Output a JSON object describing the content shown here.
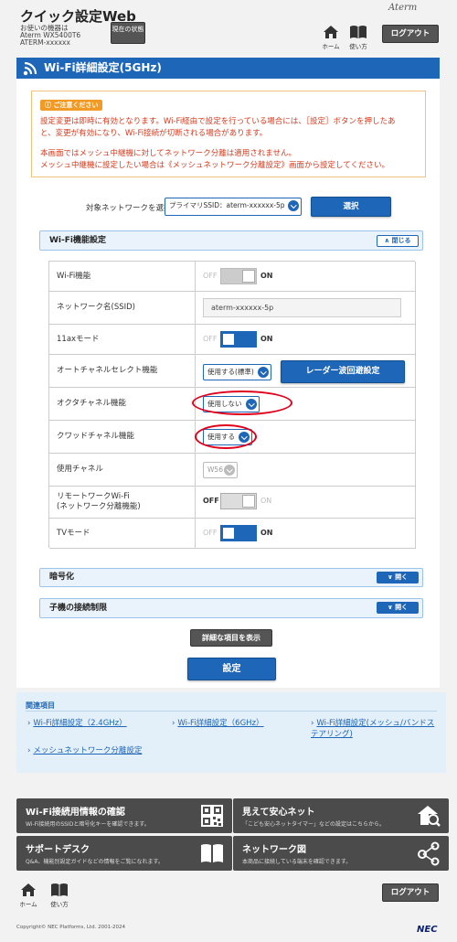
{
  "header": {
    "app_title": "クイック設定Web",
    "device_label": "お使いの機器は",
    "device_model": "Aterm WX5400T6",
    "device_name": "ATERM-xxxxxx",
    "status_button": "現在の状態",
    "brand": "Aterm",
    "home_label": "ホーム",
    "help_label": "使い方",
    "logout_label": "ログアウト"
  },
  "page_title": "Wi-Fi詳細設定(5GHz)",
  "notice": {
    "tag": "ご注意ください",
    "line1": "設定変更は即時に有効となります。Wi-Fi経由で設定を行っている場合には、［設定］ボタンを押したあ",
    "line2": "と、変更が有効になり、Wi-Fi接続が切断される場合があります。",
    "line3": "本画面ではメッシュ中継機に対してネットワーク分離は適用されません。",
    "line4": "メッシュ中継機に設定したい場合は《メッシュネットワーク分離設定》画面から設定してください。"
  },
  "network_select": {
    "label": "対象ネットワークを選択",
    "value": "プライマリSSID：aterm-xxxxxx-5p",
    "button": "選択"
  },
  "wifi_section": {
    "title": "Wi-Fi機能設定",
    "close_label": "閉じる",
    "off": "OFF",
    "on": "ON",
    "rows": {
      "wifi": {
        "label": "Wi-Fi機能",
        "state": "OFF"
      },
      "ssid": {
        "label": "ネットワーク名(SSID)",
        "value": "aterm-xxxxxx-5p"
      },
      "ax": {
        "label": "11axモード",
        "state": "ON"
      },
      "autochannel": {
        "label": "オートチャネルセレクト機能",
        "value": "使用する(標準)",
        "button": "レーダー波回避設定"
      },
      "octa": {
        "label": "オクタチャネル機能",
        "value": "使用しない"
      },
      "quad": {
        "label": "クワッドチャネル機能",
        "value": "使用する"
      },
      "channel": {
        "label": "使用チャネル",
        "value": "W56"
      },
      "remote": {
        "label_line1": "リモートワークWi-Fi",
        "label_line2": "(ネットワーク分離機能)",
        "state": "OFF"
      },
      "tv": {
        "label": "TVモード",
        "state": "ON"
      }
    }
  },
  "encryption_section": {
    "title": "暗号化",
    "open_label": "開く"
  },
  "client_section": {
    "title": "子機の接続制限",
    "open_label": "開く"
  },
  "show_details_button": "詳細な項目を表示",
  "apply_button": "設定",
  "related": {
    "title": "関連項目",
    "links": [
      "Wi-Fi詳細設定（2.4GHz）",
      "Wi-Fi詳細設定（6GHz）",
      "Wi-Fi詳細設定(メッシュ/バンドステアリング)",
      "メッシュネットワーク分離設定"
    ]
  },
  "tiles": [
    {
      "title": "Wi-Fi接続用情報の確認",
      "desc": "Wi-Fi接続用のSSIDと暗号化キーを確認できます。",
      "icon": "qr-code-icon"
    },
    {
      "title": "見えて安心ネット",
      "desc": "「こども安心ネットタイマー」などの設定はこちらから。",
      "icon": "home-search-icon"
    },
    {
      "title": "サポートデスク",
      "desc": "Q&A、機能別設定ガイドなどの情報をご覧になれます。",
      "icon": "book-icon"
    },
    {
      "title": "ネットワーク図",
      "desc": "本商品に接続している端末を確認できます。",
      "icon": "network-icon"
    }
  ],
  "footer": {
    "home_label": "ホーム",
    "help_label": "使い方",
    "logout_label": "ログアウト",
    "copyright": "Copyright© NEC Platforms, Ltd. 2001-2024",
    "logo": "NEC"
  },
  "colors": {
    "primary": "#1e66b8",
    "notice_red": "#d63b1f",
    "tile_dark": "#4b4b4b",
    "highlight_ring": "#e0001b"
  }
}
